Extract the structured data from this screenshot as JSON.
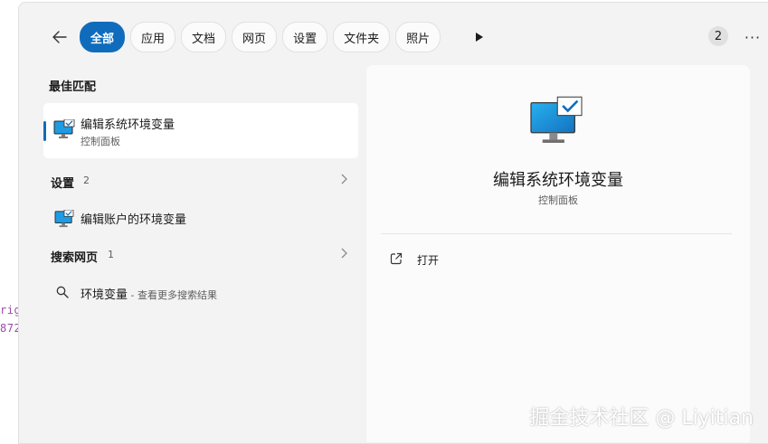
{
  "background_code": {
    "line1": "rig",
    "line2": "872"
  },
  "toolbar": {
    "tabs": [
      {
        "label": "全部"
      },
      {
        "label": "应用"
      },
      {
        "label": "文档"
      },
      {
        "label": "网页"
      },
      {
        "label": "设置"
      },
      {
        "label": "文件夹"
      },
      {
        "label": "照片"
      }
    ],
    "result_count": "2",
    "more_label": "···"
  },
  "best_match": {
    "heading": "最佳匹配",
    "item": {
      "title": "编辑系统环境变量",
      "subtitle": "控制面板"
    }
  },
  "settings_group": {
    "label": "设置",
    "count": "2",
    "items": [
      {
        "title": "编辑账户的环境变量"
      }
    ]
  },
  "web_group": {
    "label": "搜索网页",
    "count": "1",
    "items": [
      {
        "query": "环境变量",
        "hint": " - 查看更多搜索结果"
      }
    ]
  },
  "detail": {
    "title": "编辑系统环境变量",
    "subtitle": "控制面板",
    "actions": [
      {
        "label": "打开"
      }
    ]
  },
  "watermark": "掘金技术社区 @ Liyitian",
  "colors": {
    "accent": "#0f6cbd",
    "panel": "#f3f3f3",
    "detail": "#fbfbfb"
  }
}
